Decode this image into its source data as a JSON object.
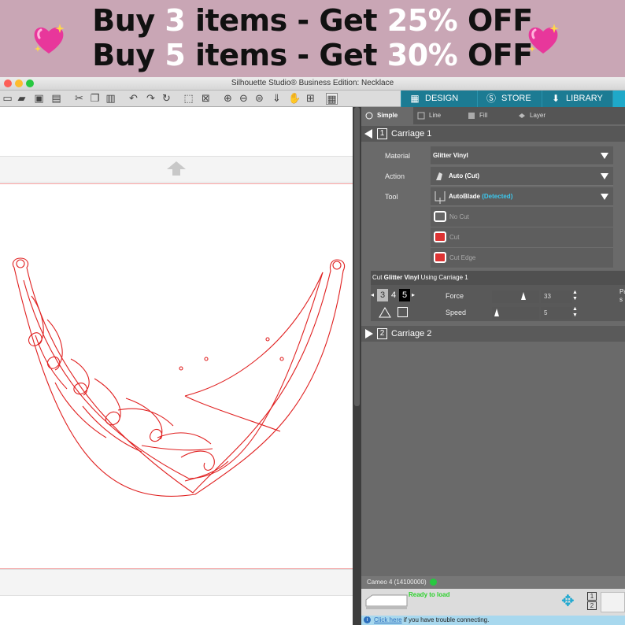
{
  "banner": {
    "line1": {
      "pre": "Buy ",
      "qty": "3",
      "mid": " items - Get ",
      "pct": "25%",
      "post": " OFF"
    },
    "line2": {
      "pre": "Buy ",
      "qty": "5",
      "mid": " items - Get ",
      "pct": "30%",
      "post": " OFF"
    },
    "left_icon": "sparkling-heart-icon",
    "right_icon": "sparkling-heart-icon",
    "colors": {
      "background": "#c9a6b5",
      "highlight": "#ffffff",
      "text": "#111111",
      "heart": "#e8379b"
    }
  },
  "window": {
    "title": "Silhouette Studio® Business Edition: Necklace",
    "traffic_lights": [
      "#fc5f57",
      "#fdbc2e",
      "#27c840"
    ]
  },
  "toolbar": {
    "icons": [
      "new-document-icon",
      "open-folder-icon",
      "save-icon",
      "print-icon",
      "cut-icon",
      "copy-icon",
      "paste-icon",
      "undo-icon",
      "redo-icon",
      "refresh-icon",
      "select-all-icon",
      "deselect-icon",
      "zoom-in-icon",
      "zoom-out-icon",
      "move-down-icon",
      "pan-hand-icon",
      "zoom-fit-icon",
      "pattern-icon"
    ],
    "tabs": [
      {
        "label": "DESIGN",
        "icon": "grid-icon"
      },
      {
        "label": "STORE",
        "icon": "store-s-icon"
      },
      {
        "label": "LIBRARY",
        "icon": "library-download-icon"
      }
    ],
    "accent": "#1c7b93"
  },
  "canvas": {
    "cut_line_color": "#e02020",
    "design": "necklace"
  },
  "panel": {
    "subtabs": [
      "Simple",
      "Line",
      "Fill",
      "Layer"
    ],
    "carriage1": {
      "number": "1",
      "label": "Carriage 1"
    },
    "material": {
      "label": "Material",
      "value": "Glitter Vinyl"
    },
    "action": {
      "label": "Action",
      "value": "Auto (Cut)"
    },
    "tool": {
      "label": "Tool",
      "value": "AutoBlade",
      "detected": "(Detected)"
    },
    "cut_options": [
      "No Cut",
      "Cut",
      "Cut Edge"
    ],
    "settings": {
      "header_pre": "Cut ",
      "header_material": "Glitter Vinyl",
      "header_post": " Using Carriage 1",
      "blade_digits": [
        "3",
        "4",
        "5"
      ],
      "force_label": "Force",
      "force_value": "33",
      "speed_label": "Speed",
      "speed_value": "5",
      "force_level": 0.66,
      "speed_level": 0.1,
      "side_label_1": "Pa",
      "side_label_2": "s"
    },
    "carriage2": {
      "number": "2",
      "label": "Carriage 2"
    },
    "device": "Cameo 4 (14100000)",
    "status": "Ready to load",
    "help": {
      "link": "Click here",
      "rest": " if you have trouble connecting."
    },
    "carriage_nums": [
      "1",
      "2"
    ]
  }
}
